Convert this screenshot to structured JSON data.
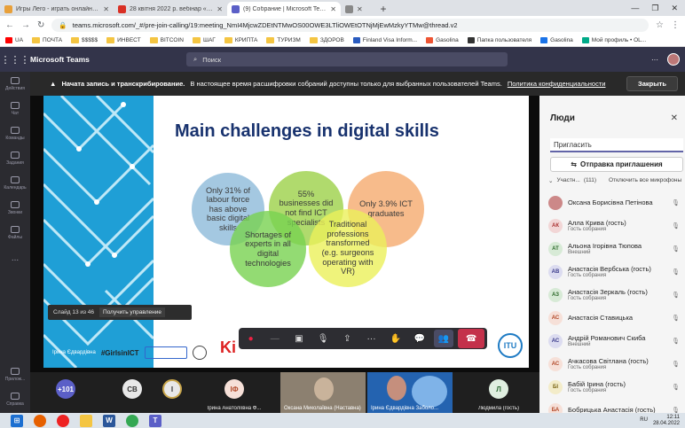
{
  "browser": {
    "tabs": [
      {
        "title": "Игры Лего - играть онлайн бесплатно",
        "color": "#e8a03a"
      },
      {
        "title": "28 квітня 2022 р. вебінар «Гендер»",
        "color": "#d93025"
      },
      {
        "title": "(9) Собрание | Microsoft Teams",
        "color": "#5b5fc7",
        "active": true
      },
      {
        "title": "",
        "color": "#888"
      }
    ],
    "url": "teams.microsoft.com/_#/pre-join-calling/19:meeting_NmI4MjcwZDEtNTMwOS00OWE3LTliOWEtOTNjMjEwMzkyYTMw@thread.v2",
    "bookmarks": [
      "UA",
      "ПОЧТА",
      "$$$$$",
      "ИНВЕСТ",
      "BITCOIN",
      "ШАГ",
      "КРИПТА",
      "ТУРИЗМ",
      "ЗДОРОВ",
      "Finland Visa Inform...",
      "Gasolina",
      "Папка пользователя",
      "Gasolina",
      "Мой профиль • OL..."
    ]
  },
  "teams": {
    "brand": "Microsoft Teams",
    "search_placeholder": "Поиск",
    "rail": [
      "Действия",
      "Чат",
      "Команды",
      "Задания",
      "Календарь",
      "Звонки",
      "Файлы",
      "...",
      "Прилож...",
      "Справка"
    ],
    "banner": {
      "bold": "Начата запись и транскрибирование.",
      "text": "В настоящее время расшифровки собраний доступны только для выбранных пользователей Teams.",
      "link": "Политика конфиденциальности",
      "close_label": "Закрыть"
    }
  },
  "slide": {
    "title": "Main challenges in digital skills",
    "circles": [
      "Only 31% of labour force has above basic digital skills",
      "55% businesses did not find ICT specialists",
      "Only 3.9% ICT graduates",
      "Shortages of experts in all digital technologies",
      "Traditional professions transformed (e.g. surgeons operating with VR)"
    ],
    "hashtag": "#GirlsinICT",
    "footer_name": "Ірина Єдвардівна",
    "itu": "ITU",
    "ki": "Ki",
    "slide_counter": "Слайд 13 из 46",
    "take_control": "Получить управление"
  },
  "strip": {
    "tiles": [
      {
        "text": "+101",
        "name": "",
        "color": "#5b5fc7",
        "fg": "#fff"
      },
      {
        "text": "СВ",
        "name": "",
        "color": "#e8e8e8",
        "fg": "#333"
      },
      {
        "text": "І",
        "name": "",
        "color": "#e8e8e8",
        "fg": "#333"
      },
      {
        "text": "ІФ",
        "name": "Ірина Анатоліївна Ф...",
        "color": "#f6e0d8",
        "fg": "#b24a2a"
      },
      {
        "text": "Л",
        "name": "Людмила (гость)",
        "color": "#dfeee0",
        "fg": "#2c6a33"
      }
    ],
    "video1_name": "Оксана Миколаївна (Наставна)",
    "video2_name": "Ірина Єдвардівна Заболо..."
  },
  "people": {
    "header": "Люди",
    "invite_placeholder": "Пригласить",
    "share_label": "Отправка приглашения",
    "participants_label": "Участн...",
    "participants_count": "(111)",
    "mute_all": "Отключить все микрофоны",
    "list": [
      {
        "initials": "",
        "name": "Оксана Борисівна Петінова",
        "role": "",
        "color": "#c88"
      },
      {
        "initials": "АК",
        "name": "Алла Крива (гость)",
        "role": "Гость собрания",
        "color": "#f2d6d6",
        "fg": "#a33"
      },
      {
        "initials": "АТ",
        "name": "Альона Ігорівна Тюпова",
        "role": "Внешний",
        "color": "#d7ead6",
        "fg": "#2d6a2b"
      },
      {
        "initials": "АВ",
        "name": "Анастасія Вербська (гость)",
        "role": "Гость собрания",
        "color": "#dcdcf0",
        "fg": "#3d3d8c"
      },
      {
        "initials": "АЗ",
        "name": "Анастасія Зеркаль (гость)",
        "role": "Гость собрания",
        "color": "#d7ead6",
        "fg": "#2d6a2b"
      },
      {
        "initials": "АС",
        "name": "Анастасія Ставицька",
        "role": "",
        "color": "#f6e0d8",
        "fg": "#b24a2a"
      },
      {
        "initials": "АС",
        "name": "Андрій Романович Скиба",
        "role": "Внешний",
        "color": "#dcdcf0",
        "fg": "#3d3d8c"
      },
      {
        "initials": "АС",
        "name": "Ачкасова Світлана (гость)",
        "role": "Гость собрания",
        "color": "#f6e0d8",
        "fg": "#b24a2a"
      },
      {
        "initials": "БІ",
        "name": "Бабій Ірина (гость)",
        "role": "Гость собрания",
        "color": "#f3ecc9",
        "fg": "#7a6514"
      },
      {
        "initials": "БА",
        "name": "Бобрицька Анастасія (гость)",
        "role": "",
        "color": "#f6e0d8",
        "fg": "#b24a2a"
      }
    ]
  },
  "taskbar": {
    "lang": "RU",
    "time": "12:11",
    "date": "28.04.2022"
  }
}
